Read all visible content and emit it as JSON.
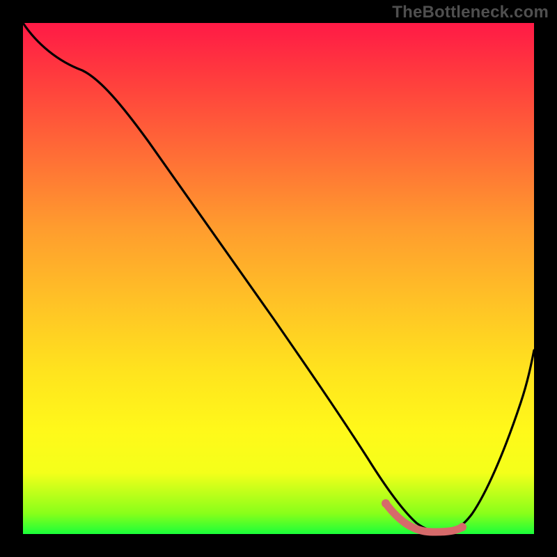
{
  "watermark": "TheBottleneck.com",
  "colors": {
    "background": "#000000",
    "gradient_top": "#ff1a46",
    "gradient_bottom": "#1aff3a",
    "curve": "#000000",
    "highlight": "#d66a6a",
    "watermark": "#4f4f4f"
  },
  "chart_data": {
    "type": "line",
    "title": "",
    "xlabel": "",
    "ylabel": "",
    "xlim": [
      0,
      100
    ],
    "ylim": [
      0,
      100
    ],
    "gradient_axis": "y",
    "gradient_meaning": "bottleneck severity (red high, green low)",
    "series": [
      {
        "name": "bottleneck-curve",
        "x": [
          0,
          5,
          12,
          20,
          30,
          40,
          50,
          57,
          62,
          67,
          72,
          76,
          80,
          84,
          90,
          96,
          100
        ],
        "y": [
          100,
          96,
          92,
          83,
          70,
          56,
          43,
          33,
          24,
          15,
          7,
          3,
          1,
          1,
          9,
          28,
          45
        ],
        "note": "y is distance above the bottom (0 = bottom/green, 100 = top/red)"
      }
    ],
    "annotations": [
      {
        "name": "optimal-range-highlight",
        "x_range": [
          71,
          85
        ],
        "y": 2,
        "style": "thick-muted-red"
      }
    ]
  }
}
